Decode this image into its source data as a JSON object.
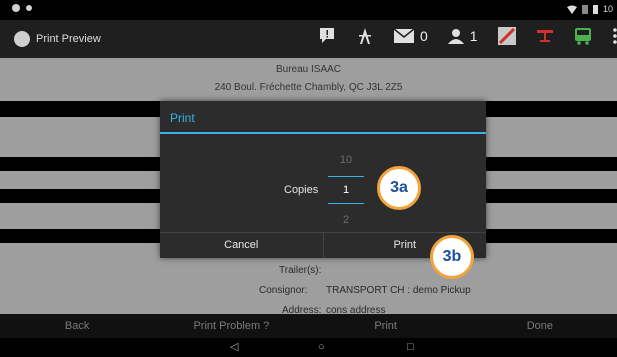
{
  "status_bar": {
    "left_icons": [
      "notification-icon",
      "settings-icon"
    ],
    "right_icons": [
      "wifi-icon",
      "signal-icon",
      "battery-icon"
    ],
    "time": "10"
  },
  "action_bar": {
    "title": "Print Preview",
    "app_icon": "app-logo-icon",
    "message_count": "0",
    "user_count": "1",
    "accent_colors": {
      "red_icon": "#d32f2f",
      "green_icon": "#4caf50"
    }
  },
  "document": {
    "company_name": "Bureau ISAAC",
    "address_line": "240 Boul. Fréchette Chambly, QC J3L 2Z5",
    "trailers_label": "Trailer(s):",
    "consignor_label": "Consignor:",
    "consignor_value": "TRANSPORT CH : demo Pickup",
    "address_label": "Address:",
    "address_value": "cons address"
  },
  "dialog": {
    "title": "Print",
    "copies_label": "Copies",
    "copies_value": "1",
    "picker_prev": "10",
    "picker_next": "2",
    "cancel_label": "Cancel",
    "print_label": "Print",
    "accent": "#33b5e5"
  },
  "bottom_bar": {
    "back": "Back",
    "print_problem": "Print Problem ?",
    "print": "Print",
    "done": "Done"
  },
  "callouts": {
    "a": "3a",
    "b": "3b",
    "border_color": "#f3a33b",
    "text_color": "#1b4fa0"
  }
}
